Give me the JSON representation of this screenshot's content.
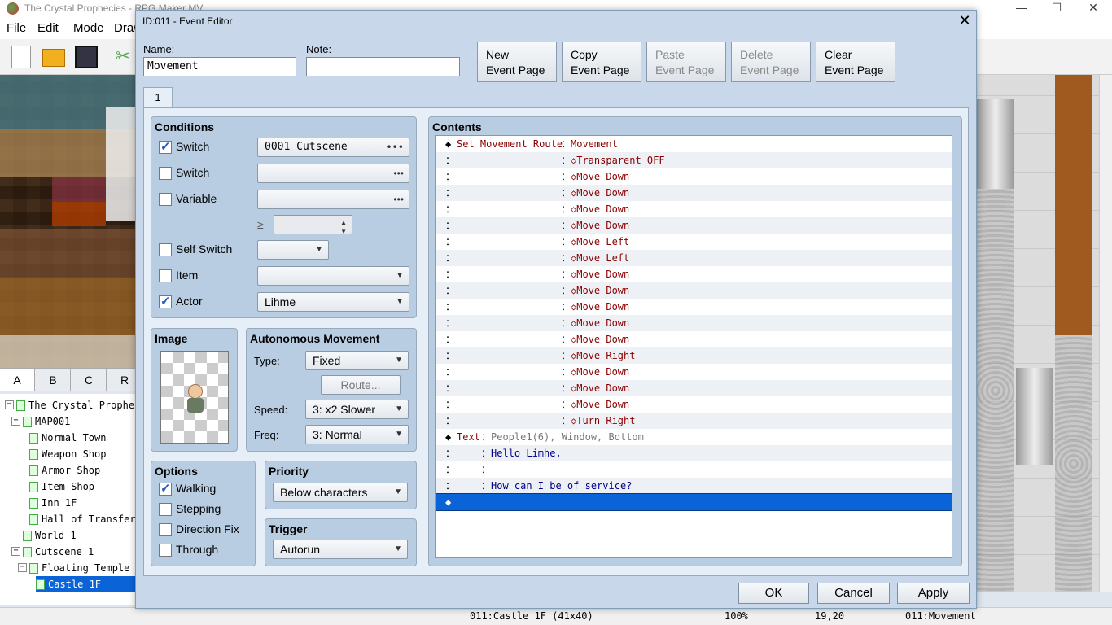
{
  "app": {
    "title": "The Crystal Prophecies - RPG Maker MV",
    "minimize": "—",
    "maximize": "☐",
    "close": "✕"
  },
  "menu": [
    "File",
    "Edit",
    "Mode",
    "Draw"
  ],
  "tile_tabs": [
    "A",
    "B",
    "C",
    "R"
  ],
  "map_tree": [
    {
      "label": "The Crystal Prophe",
      "indent": 0,
      "toggle": "⊟"
    },
    {
      "label": "MAP001",
      "indent": 1,
      "toggle": "⊟"
    },
    {
      "label": "Normal Town",
      "indent": 2
    },
    {
      "label": "Weapon Shop",
      "indent": 2
    },
    {
      "label": "Armor Shop",
      "indent": 2
    },
    {
      "label": "Item Shop",
      "indent": 2
    },
    {
      "label": "Inn 1F",
      "indent": 2
    },
    {
      "label": "Hall of Transfer",
      "indent": 2
    },
    {
      "label": "World 1",
      "indent": 1
    },
    {
      "label": "Cutscene 1",
      "indent": 1,
      "toggle": "⊟"
    },
    {
      "label": "Floating Temple",
      "indent": 2,
      "toggle": "⊟"
    },
    {
      "label": "Castle 1F",
      "indent": 3,
      "selected": true
    }
  ],
  "statusbar": {
    "map": "011:Castle 1F (41x40)",
    "zoom": "100%",
    "coords": "19,20",
    "event": "011:Movement"
  },
  "dialog": {
    "title": "ID:011 - Event Editor",
    "close": "✕",
    "name_label": "Name:",
    "name_value": "Movement",
    "note_label": "Note:",
    "note_value": "",
    "page_buttons": [
      {
        "line1": "New",
        "line2": "Event Page",
        "enabled": true
      },
      {
        "line1": "Copy",
        "line2": "Event Page",
        "enabled": true
      },
      {
        "line1": "Paste",
        "line2": "Event Page",
        "enabled": false
      },
      {
        "line1": "Delete",
        "line2": "Event Page",
        "enabled": false
      },
      {
        "line1": "Clear",
        "line2": "Event Page",
        "enabled": true
      }
    ],
    "page_tab": "1",
    "conditions": {
      "title": "Conditions",
      "switch1": {
        "label": "Switch",
        "checked": true,
        "value": "0001 Cutscene"
      },
      "switch2": {
        "label": "Switch",
        "checked": false,
        "value": ""
      },
      "variable": {
        "label": "Variable",
        "checked": false,
        "value": ""
      },
      "gte": "≥",
      "self_switch": {
        "label": "Self Switch",
        "checked": false
      },
      "item": {
        "label": "Item",
        "checked": false
      },
      "actor": {
        "label": "Actor",
        "checked": true,
        "value": "Lihme"
      }
    },
    "image": {
      "title": "Image"
    },
    "autonomous": {
      "title": "Autonomous Movement",
      "type_label": "Type:",
      "type_value": "Fixed",
      "route_button": "Route...",
      "speed_label": "Speed:",
      "speed_value": "3: x2 Slower",
      "freq_label": "Freq:",
      "freq_value": "3: Normal"
    },
    "options": {
      "title": "Options",
      "items": [
        {
          "label": "Walking",
          "checked": true
        },
        {
          "label": "Stepping",
          "checked": false
        },
        {
          "label": "Direction Fix",
          "checked": false
        },
        {
          "label": "Through",
          "checked": false
        }
      ]
    },
    "priority": {
      "title": "Priority",
      "value": "Below characters"
    },
    "trigger": {
      "title": "Trigger",
      "value": "Autorun"
    },
    "contents": {
      "title": "Contents",
      "rows": [
        {
          "a": "◆",
          "b": "Set Movement Route",
          "c": "：",
          "d": "Movement",
          "style": "red"
        },
        {
          "a": "：",
          "b": "",
          "c": "：",
          "d": "◇Transparent OFF",
          "style": "red"
        },
        {
          "a": "：",
          "b": "",
          "c": "：",
          "d": "◇Move Down",
          "style": "red"
        },
        {
          "a": "：",
          "b": "",
          "c": "：",
          "d": "◇Move Down",
          "style": "red"
        },
        {
          "a": "：",
          "b": "",
          "c": "：",
          "d": "◇Move Down",
          "style": "red"
        },
        {
          "a": "：",
          "b": "",
          "c": "：",
          "d": "◇Move Down",
          "style": "red"
        },
        {
          "a": "：",
          "b": "",
          "c": "：",
          "d": "◇Move Left",
          "style": "red"
        },
        {
          "a": "：",
          "b": "",
          "c": "：",
          "d": "◇Move Left",
          "style": "red"
        },
        {
          "a": "：",
          "b": "",
          "c": "：",
          "d": "◇Move Down",
          "style": "red"
        },
        {
          "a": "：",
          "b": "",
          "c": "：",
          "d": "◇Move Down",
          "style": "red"
        },
        {
          "a": "：",
          "b": "",
          "c": "：",
          "d": "◇Move Down",
          "style": "red"
        },
        {
          "a": "：",
          "b": "",
          "c": "：",
          "d": "◇Move Down",
          "style": "red"
        },
        {
          "a": "：",
          "b": "",
          "c": "：",
          "d": "◇Move Down",
          "style": "red"
        },
        {
          "a": "：",
          "b": "",
          "c": "：",
          "d": "◇Move Right",
          "style": "red"
        },
        {
          "a": "：",
          "b": "",
          "c": "：",
          "d": "◇Move Down",
          "style": "red"
        },
        {
          "a": "：",
          "b": "",
          "c": "：",
          "d": "◇Move Down",
          "style": "red"
        },
        {
          "a": "：",
          "b": "",
          "c": "：",
          "d": "◇Move Down",
          "style": "red"
        },
        {
          "a": "：",
          "b": "",
          "c": "：",
          "d": "◇Turn Right",
          "style": "red"
        },
        {
          "a": "◆",
          "b": "Text",
          "c": "：",
          "d": "People1(6), Window, Bottom",
          "style": "text"
        },
        {
          "a": "：",
          "b": "",
          "c": "：",
          "d": "Hello Limhe,",
          "style": "blue"
        },
        {
          "a": "：",
          "b": "",
          "c": "：",
          "d": "",
          "style": "blue"
        },
        {
          "a": "：",
          "b": "",
          "c": "：",
          "d": "How can I be of service?",
          "style": "blue"
        },
        {
          "a": "◆",
          "b": "",
          "c": "",
          "d": "",
          "style": "sel"
        }
      ]
    },
    "ok": "OK",
    "cancel": "Cancel",
    "apply": "Apply"
  }
}
